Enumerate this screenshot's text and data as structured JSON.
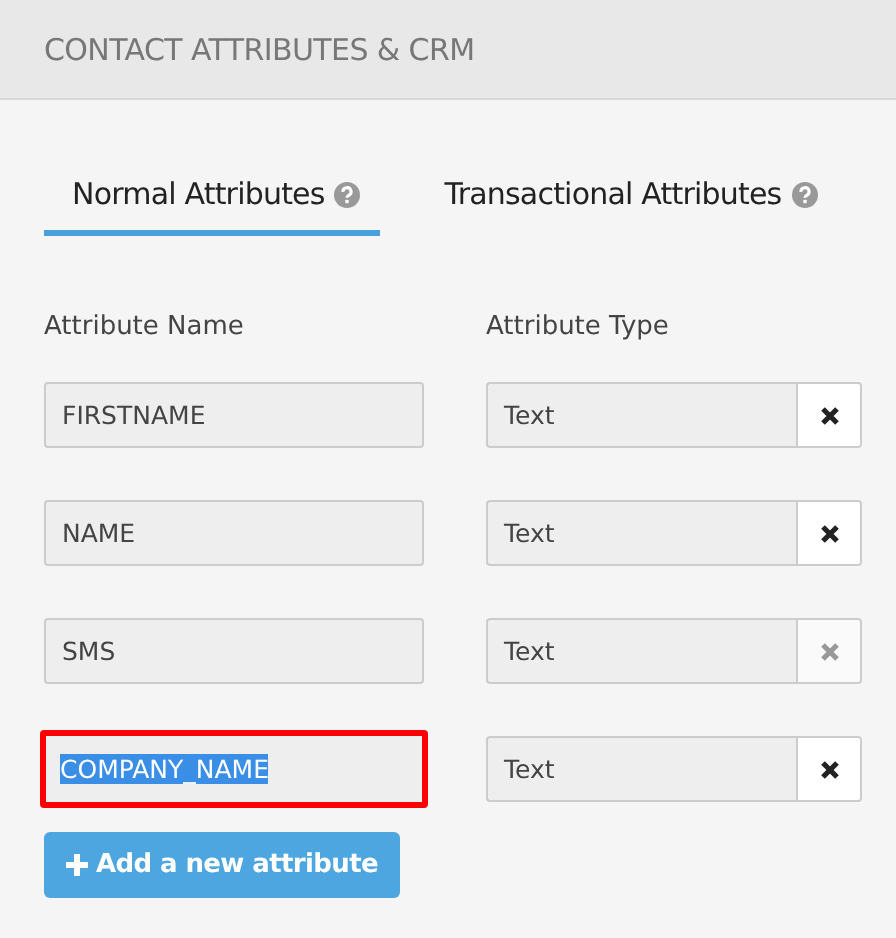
{
  "header": {
    "title": "CONTACT ATTRIBUTES & CRM"
  },
  "tabs": [
    {
      "label": "Normal Attributes",
      "selected": true
    },
    {
      "label": "Transactional Attributes",
      "selected": false
    }
  ],
  "columns": [
    "Attribute Name",
    "Attribute Type"
  ],
  "attributes": [
    {
      "name": "FIRSTNAME",
      "type": "Text",
      "delete_disabled": false,
      "highlighted": false,
      "text_selected": false
    },
    {
      "name": "NAME",
      "type": "Text",
      "delete_disabled": false,
      "highlighted": false,
      "text_selected": false
    },
    {
      "name": "SMS",
      "type": "Text",
      "delete_disabled": true,
      "highlighted": false,
      "text_selected": false
    },
    {
      "name": "COMPANY_NAME",
      "type": "Text",
      "delete_disabled": false,
      "highlighted": true,
      "text_selected": true
    }
  ],
  "add_button": {
    "label": "Add a new attribute"
  }
}
